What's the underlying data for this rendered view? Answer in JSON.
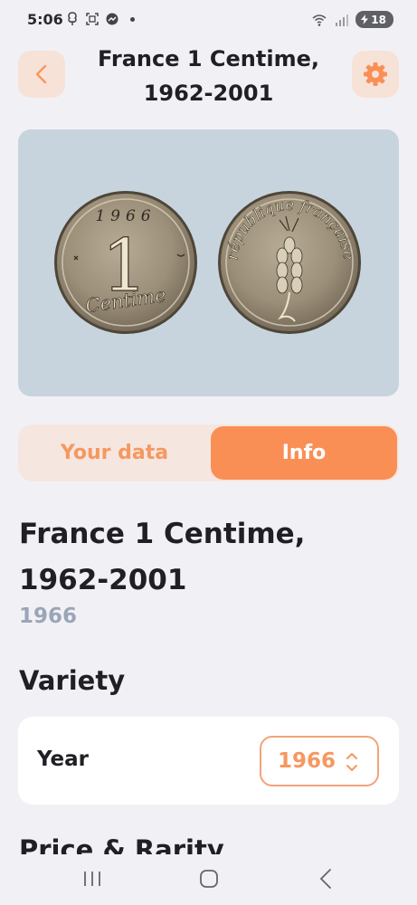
{
  "status_bar": {
    "time": "5:06",
    "battery": "18"
  },
  "header": {
    "title_line1": "France 1 Centime,",
    "title_line2": "1962-2001"
  },
  "coin_image": {
    "obverse_year": "1966",
    "obverse_value": "1",
    "obverse_word": "Centime",
    "reverse_text": "république française"
  },
  "tabs": {
    "your_data": "Your data",
    "info": "Info",
    "active": "info"
  },
  "coin": {
    "name_line1": "France 1 Centime,",
    "name_line2": "1962-2001",
    "year": "1966"
  },
  "variety": {
    "heading": "Variety",
    "year_label": "Year",
    "year_value": "1966"
  },
  "next_section": {
    "heading": "Price & Rarity"
  },
  "colors": {
    "accent": "#fa8f55",
    "accent_soft": "#f7e2d8",
    "background": "#f1f1f5",
    "muted": "#9aa5b8"
  }
}
